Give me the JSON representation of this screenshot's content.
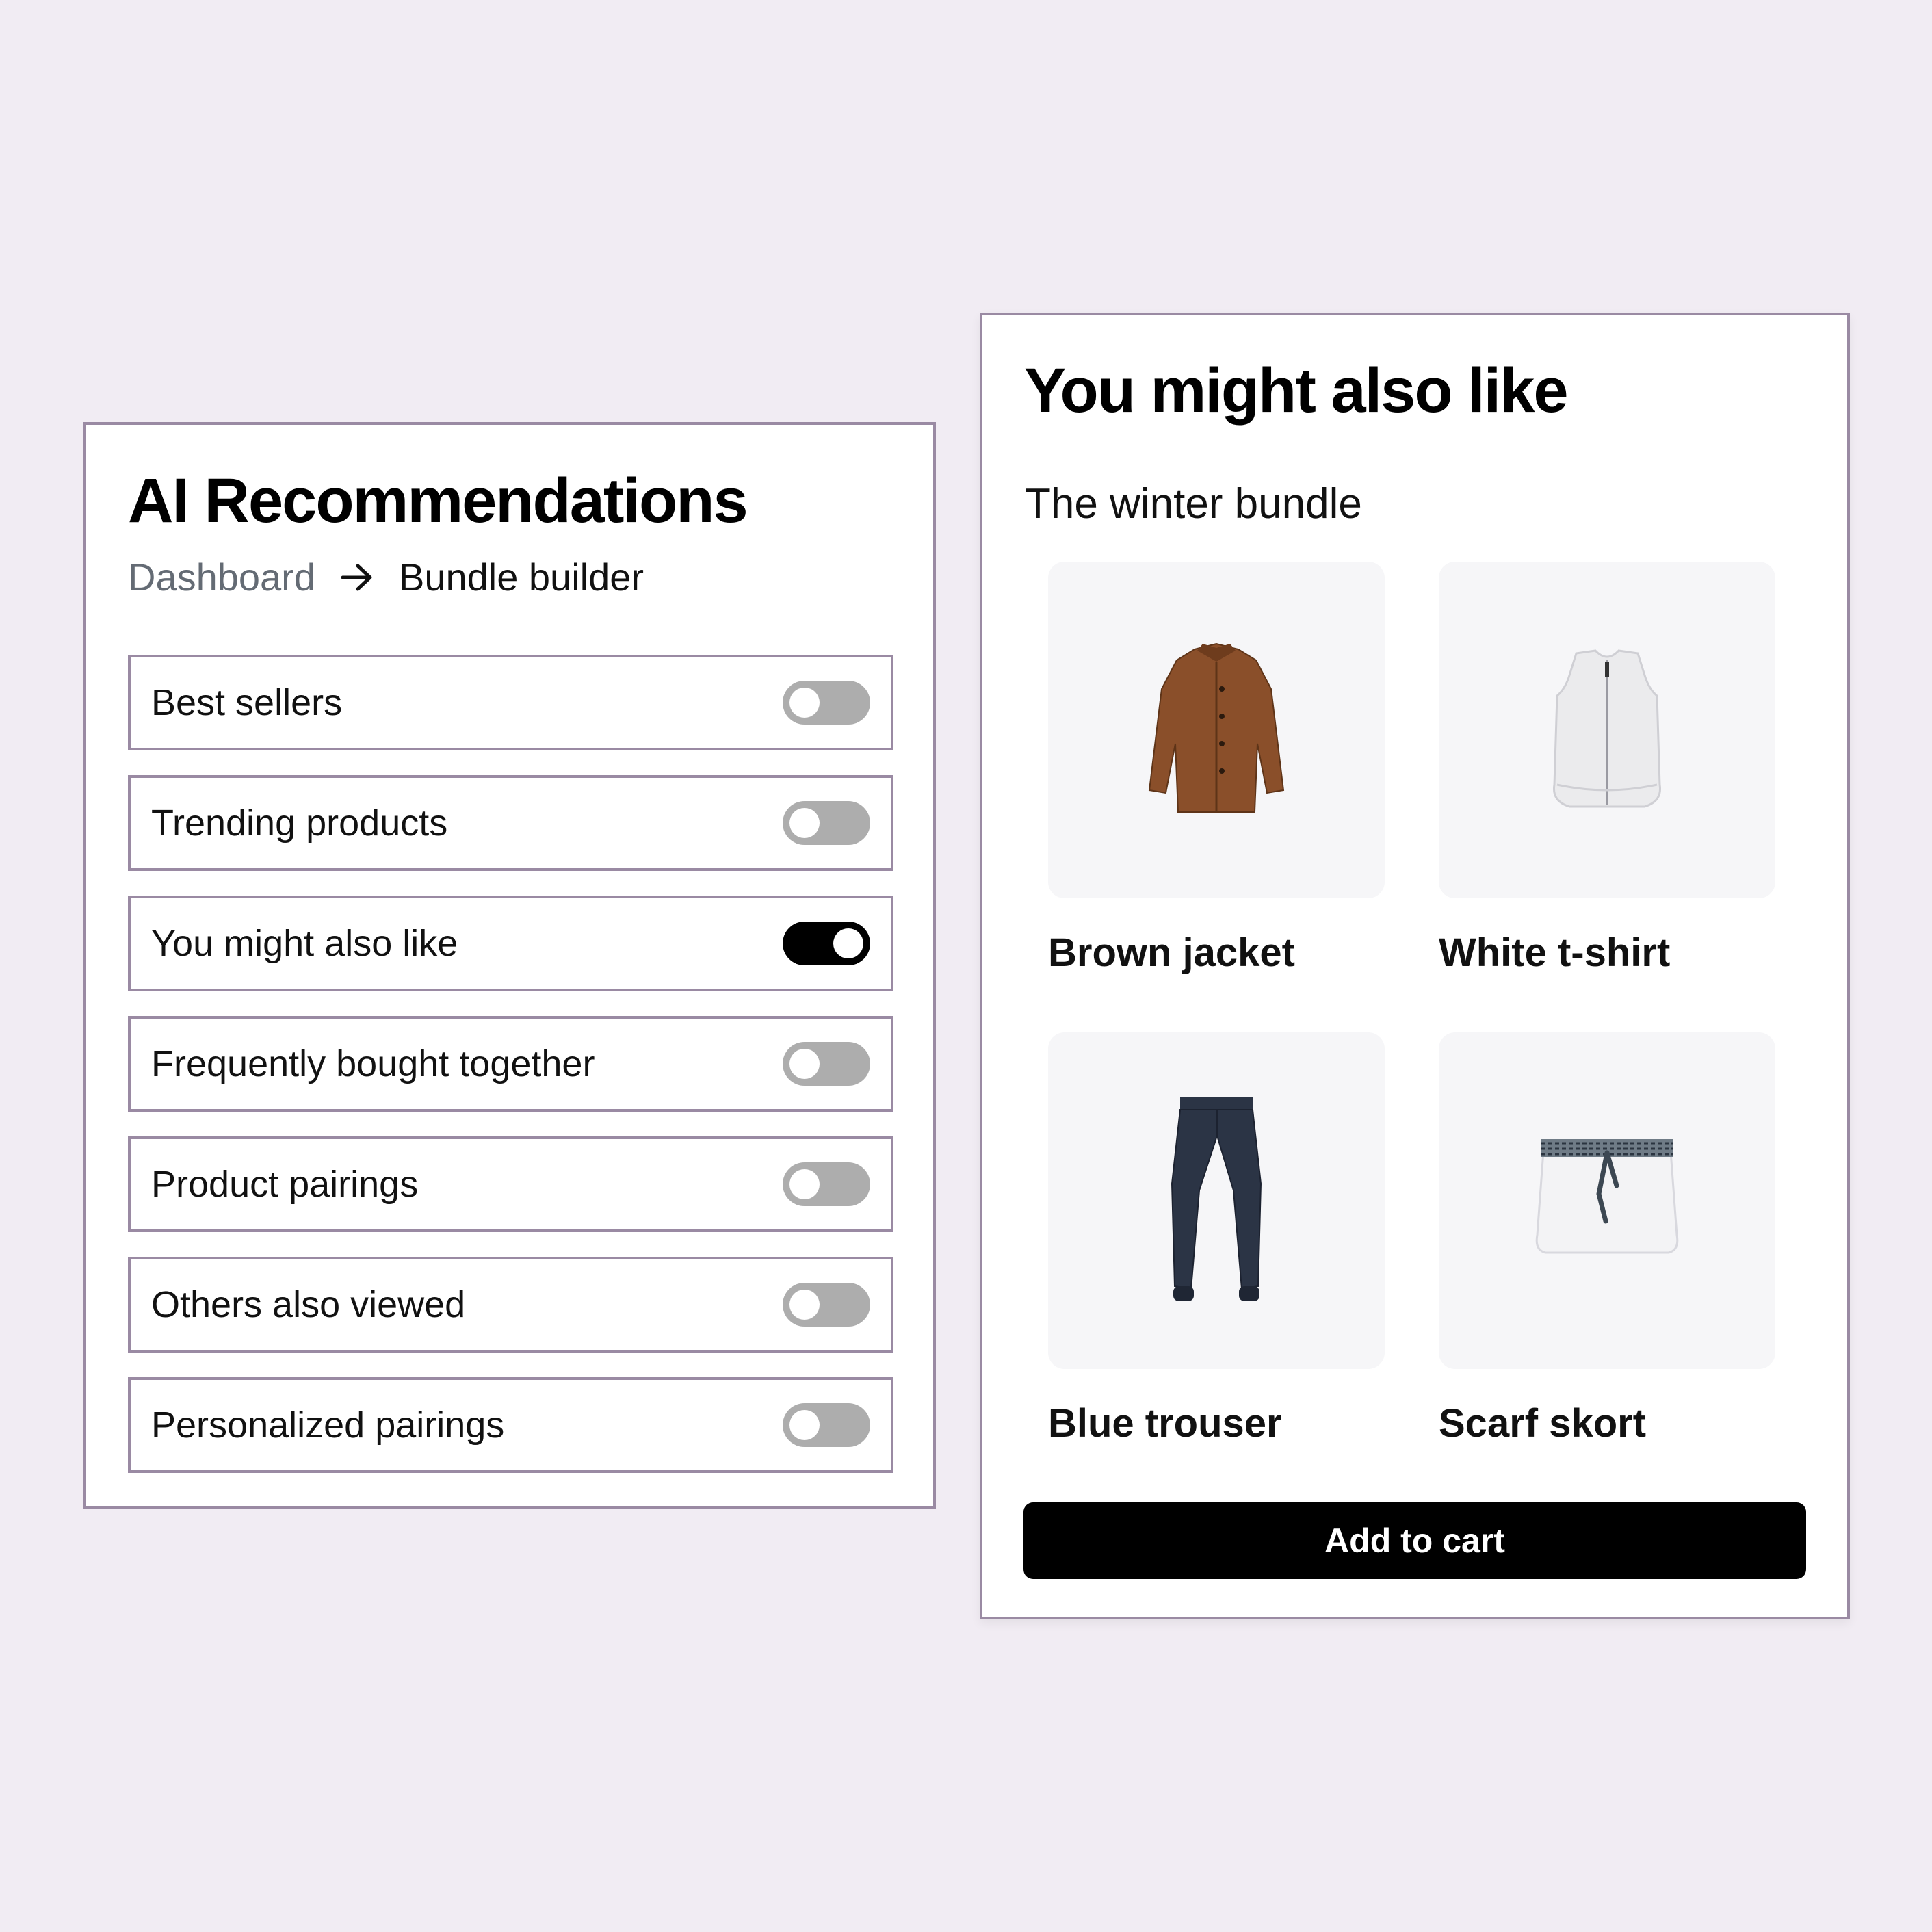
{
  "recommendations": {
    "title": "AI Recommendations",
    "breadcrumb": {
      "home": "Dashboard",
      "current": "Bundle builder"
    },
    "options": [
      {
        "label": "Best sellers",
        "enabled": false
      },
      {
        "label": "Trending products",
        "enabled": false
      },
      {
        "label": "You might also like",
        "enabled": true
      },
      {
        "label": "Frequently bought together",
        "enabled": false
      },
      {
        "label": "Product pairings",
        "enabled": false
      },
      {
        "label": "Others also viewed",
        "enabled": false
      },
      {
        "label": "Personalized pairings",
        "enabled": false
      }
    ]
  },
  "preview": {
    "title": "You might also like",
    "bundle_name": "The winter bundle",
    "products": [
      {
        "name": "Brown jacket",
        "icon": "jacket-icon",
        "color": "#8a4f2a"
      },
      {
        "name": "White t-shirt",
        "icon": "vest-icon",
        "color": "#ebebed"
      },
      {
        "name": "Blue trouser",
        "icon": "trouser-icon",
        "color": "#2b3445"
      },
      {
        "name": "Scarf skort",
        "icon": "skort-icon",
        "color": "#f3f3f5"
      }
    ],
    "cta_label": "Add to cart"
  },
  "colors": {
    "background": "#f1ecf3",
    "panel_border": "#9a8aa3",
    "toggle_off": "#adadad",
    "toggle_on": "#000000",
    "button_bg": "#000000"
  }
}
